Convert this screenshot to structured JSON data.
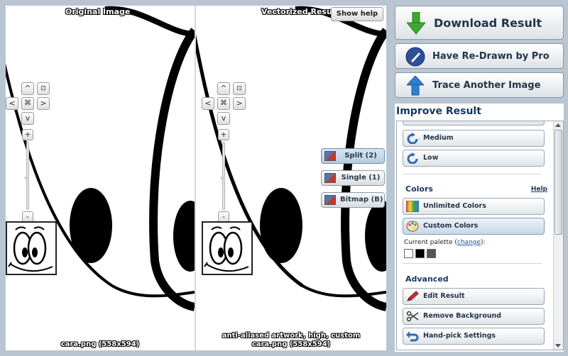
{
  "viewer": {
    "original_title": "Original Image",
    "vectorized_title": "Vectorized Result",
    "show_help": "Show help",
    "original_caption": "cara.png  (558x594)",
    "vectorized_caption_line1": "anti-aliased artwork, high, custom",
    "vectorized_caption_line2": "cara.png  (558x594)",
    "nav": {
      "up": "^",
      "left": "<",
      "right": ">",
      "down": "v",
      "center": "⌘",
      "fit": "⊡",
      "zoom_in": "+",
      "zoom_out": "-"
    },
    "modes": [
      {
        "label": "Split (2)",
        "active": true
      },
      {
        "label": "Single (1)",
        "active": false
      },
      {
        "label": "Bitmap (B)",
        "active": false
      }
    ]
  },
  "actions": {
    "download": "Download Result",
    "redraw": "Have Re-Drawn by Pro",
    "trace_another": "Trace Another Image"
  },
  "improve": {
    "title": "Improve Result",
    "quality_options": [
      "Medium",
      "Low"
    ],
    "colors": {
      "heading": "Colors",
      "help": "Help",
      "unlimited": "Unlimited Colors",
      "custom": "Custom Colors",
      "palette_label": "Current palette (",
      "palette_change": "change",
      "palette_suffix": "):",
      "swatches": [
        "#ffffff",
        "#000000",
        "#555555"
      ]
    },
    "advanced": {
      "heading": "Advanced",
      "edit": "Edit Result",
      "remove_bg": "Remove Background",
      "hand_pick": "Hand-pick Settings"
    }
  },
  "colors": {
    "accent_green": "#3daa2e",
    "accent_blue": "#2f7fd0",
    "title_blue": "#17375e"
  }
}
